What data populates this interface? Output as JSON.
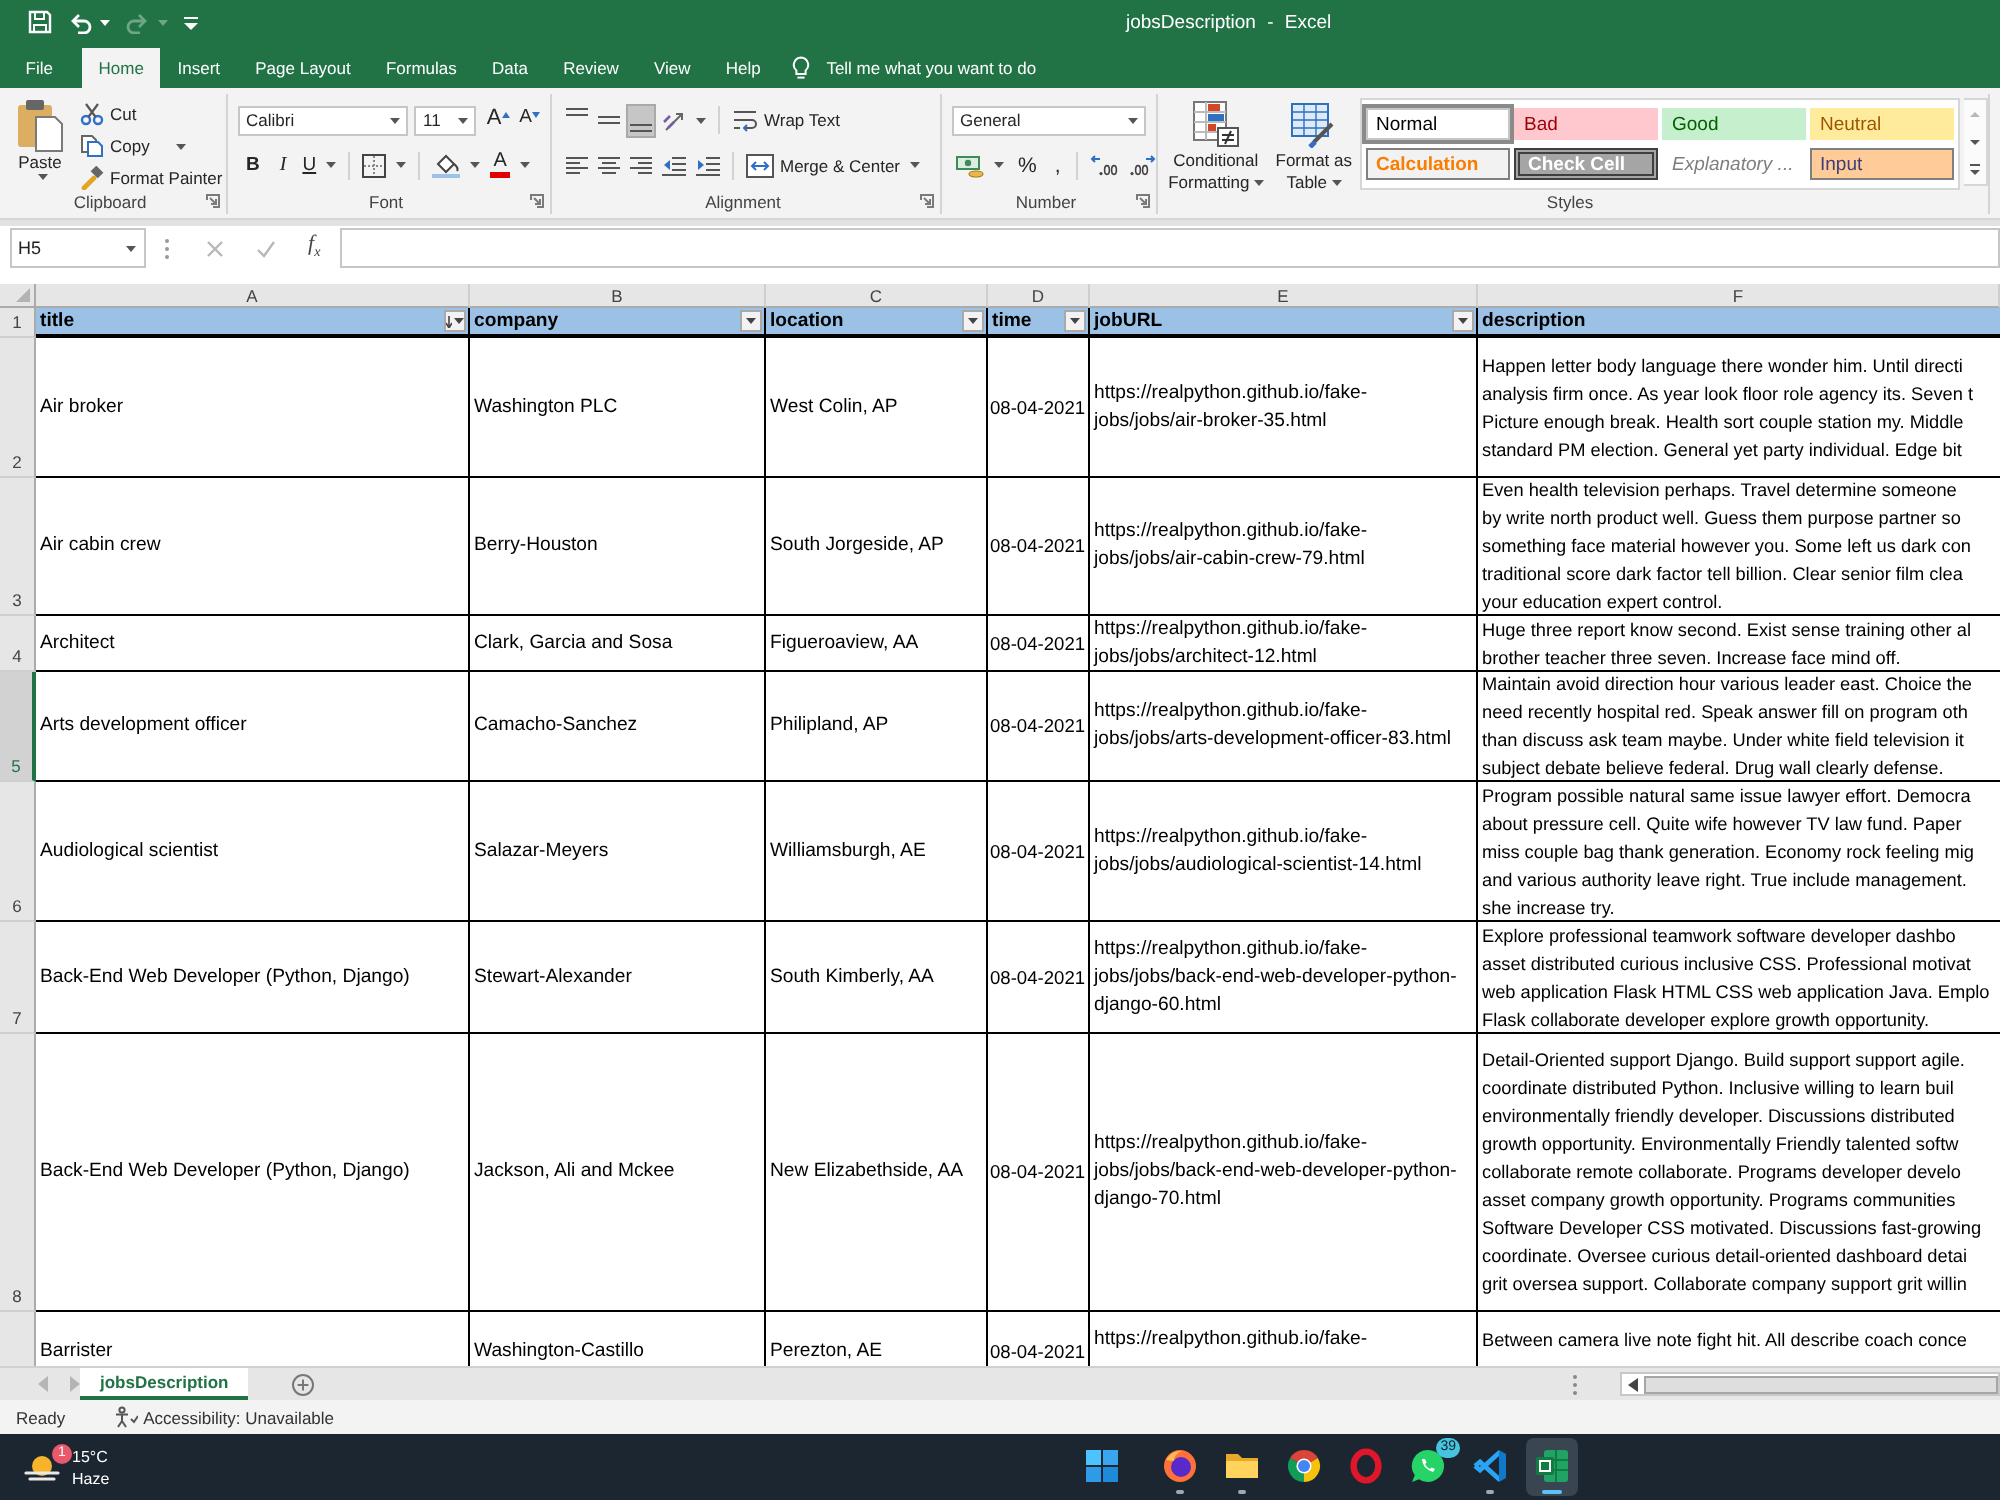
{
  "window": {
    "title": "jobsDescription - Excel"
  },
  "quick_access": [
    {
      "kind": "save",
      "disabled": false
    },
    {
      "kind": "undo",
      "disabled": false
    },
    {
      "kind": "redo",
      "disabled": true
    },
    {
      "kind": "customize",
      "disabled": false
    }
  ],
  "ribbon_tabs": [
    {
      "label": "File",
      "selected": false
    },
    {
      "label": "Home",
      "selected": true
    },
    {
      "label": "Insert",
      "selected": false
    },
    {
      "label": "Page Layout",
      "selected": false
    },
    {
      "label": "Formulas",
      "selected": false
    },
    {
      "label": "Data",
      "selected": false
    },
    {
      "label": "Review",
      "selected": false
    },
    {
      "label": "View",
      "selected": false
    },
    {
      "label": "Help",
      "selected": false
    }
  ],
  "tell_me": {
    "placeholder": "Tell me what you want to do"
  },
  "ribbon": {
    "clipboard": {
      "label": "Clipboard",
      "paste": "Paste",
      "cut": "Cut",
      "copy": "Copy",
      "format_painter": "Format Painter"
    },
    "font": {
      "label": "Font",
      "font_name": "Calibri",
      "font_size": "11",
      "grow_font": "A",
      "shrink_font": "A",
      "bold": "B",
      "italic": "I",
      "underline": "U",
      "font_color": "A"
    },
    "alignment": {
      "label": "Alignment",
      "vertical": [
        {
          "kind": "top",
          "selected": false
        },
        {
          "kind": "middle",
          "selected": false
        },
        {
          "kind": "bottom",
          "selected": true
        }
      ],
      "horizontal": [
        {
          "kind": "left",
          "selected": false
        },
        {
          "kind": "center",
          "selected": false
        },
        {
          "kind": "right",
          "selected": false
        }
      ],
      "wrap_text": "Wrap Text",
      "merge_center": "Merge & Center"
    },
    "number": {
      "label": "Number",
      "format": "General",
      "percent": "%",
      "comma": ","
    },
    "styles": {
      "label": "Styles",
      "conditional_formatting": "Conditional Formatting",
      "format_as_table": "Format as Table",
      "gallery": [
        {
          "kind": "normal",
          "label": "Normal",
          "selected": true
        },
        {
          "kind": "bad",
          "label": "Bad",
          "selected": false
        },
        {
          "kind": "good",
          "label": "Good",
          "selected": false
        },
        {
          "kind": "neutral",
          "label": "Neutral",
          "selected": false
        },
        {
          "kind": "calculation",
          "label": "Calculation",
          "selected": false
        },
        {
          "kind": "check",
          "label": "Check Cell",
          "selected": false
        },
        {
          "kind": "explanatory",
          "label": "Explanatory ...",
          "selected": false
        },
        {
          "kind": "input",
          "label": "Input",
          "selected": false
        }
      ]
    }
  },
  "formula_bar": {
    "name_box": "H5",
    "buttons": [
      {
        "kind": "cancel",
        "disabled": true
      },
      {
        "kind": "enter",
        "disabled": true
      },
      {
        "kind": "function",
        "label": "f$_{x}$",
        "disabled": false
      }
    ]
  },
  "sheet": {
    "columns": [
      "A",
      "B",
      "C",
      "D",
      "E",
      "F"
    ],
    "header": {
      "number": "1",
      "cells": [
        {
          "text": "title",
          "filter": true,
          "sorted": true
        },
        {
          "text": "company",
          "filter": true,
          "sorted": false
        },
        {
          "text": "location",
          "filter": true,
          "sorted": false
        },
        {
          "text": "time",
          "filter": true,
          "sorted": false
        },
        {
          "text": "jobURL",
          "filter": true,
          "sorted": false
        },
        {
          "text": "description",
          "filter": false
        }
      ]
    },
    "rows": [
      {
        "number": "2",
        "selected": false,
        "title": "Air broker",
        "company": "Washington PLC",
        "location": "West Colin, AP",
        "time": "08-04-2021",
        "job_url": [
          "https://realpython.github.io/fake-",
          "jobs/jobs/air-broker-35.html"
        ],
        "description": [
          "Happen letter body language there wonder him. Until directi",
          "analysis firm once. As year look floor role agency its. Seven t",
          "Picture enough break. Health sort couple station my. Middle",
          "standard PM election. General yet party individual. Edge bit"
        ]
      },
      {
        "number": "3",
        "selected": false,
        "title": "Air cabin crew",
        "company": "Berry-Houston",
        "location": "South Jorgeside, AP",
        "time": "08-04-2021",
        "job_url": [
          "https://realpython.github.io/fake-",
          "jobs/jobs/air-cabin-crew-79.html"
        ],
        "description": [
          "Even health television perhaps. Travel determine someone",
          "by write north product well. Guess them purpose partner so",
          "something face material however you. Some left us dark con",
          "traditional score dark factor tell billion. Clear senior film clea",
          "your education expert control."
        ]
      },
      {
        "number": "4",
        "selected": false,
        "title": "Architect",
        "company": "Clark, Garcia and Sosa",
        "location": "Figueroaview, AA",
        "time": "08-04-2021",
        "job_url": [
          "https://realpython.github.io/fake-",
          "jobs/jobs/architect-12.html"
        ],
        "description": [
          "Huge three report know second. Exist sense training other al",
          "brother teacher three seven. Increase face mind off."
        ]
      },
      {
        "number": "5",
        "selected": true,
        "title": "Arts development officer",
        "company": "Camacho-Sanchez",
        "location": "Philipland, AP",
        "time": "08-04-2021",
        "job_url": [
          "https://realpython.github.io/fake-",
          "jobs/jobs/arts-development-officer-83.html"
        ],
        "description": [
          "Maintain avoid direction hour various leader east. Choice the",
          "need recently hospital red. Speak answer fill on program oth",
          "than discuss ask team maybe. Under white field television it",
          "subject debate believe federal. Drug wall clearly defense."
        ]
      },
      {
        "number": "6",
        "selected": false,
        "title": "Audiological scientist",
        "company": "Salazar-Meyers",
        "location": "Williamsburgh, AE",
        "time": "08-04-2021",
        "job_url": [
          "https://realpython.github.io/fake-",
          "jobs/jobs/audiological-scientist-14.html"
        ],
        "description": [
          "Program possible natural same issue lawyer effort. Democra",
          "about pressure cell. Quite wife however TV law fund. Paper",
          "miss couple bag thank generation. Economy rock feeling mig",
          "and various authority leave right. True include management.",
          "she increase try."
        ]
      },
      {
        "number": "7",
        "selected": false,
        "title": "Back-End Web Developer (Python, Django)",
        "company": "Stewart-Alexander",
        "location": "South Kimberly, AA",
        "time": "08-04-2021",
        "job_url": [
          "https://realpython.github.io/fake-",
          "jobs/jobs/back-end-web-developer-python-",
          "django-60.html"
        ],
        "description": [
          "Explore professional teamwork software developer dashbo",
          "asset distributed curious inclusive CSS. Professional motivat",
          "web application Flask HTML CSS web application Java. Emplo",
          "Flask collaborate developer explore growth opportunity."
        ]
      },
      {
        "number": "8",
        "selected": false,
        "title": "Back-End Web Developer (Python, Django)",
        "company": "Jackson, Ali and Mckee",
        "location": "New Elizabethside, AA",
        "time": "08-04-2021",
        "job_url": [
          "https://realpython.github.io/fake-",
          "jobs/jobs/back-end-web-developer-python-",
          "django-70.html"
        ],
        "description": [
          "Detail-Oriented support Django. Build support support agile.",
          "coordinate distributed Python. Inclusive willing to learn buil",
          "environmentally friendly developer. Discussions distributed",
          "growth opportunity. Environmentally Friendly talented softw",
          "collaborate remote collaborate. Programs developer develo",
          "asset company growth opportunity. Programs communities",
          "Software Developer CSS motivated. Discussions fast-growing",
          "coordinate. Oversee curious detail-oriented dashboard detai",
          "grit oversea support. Collaborate company support grit willin"
        ]
      },
      {
        "selected": false,
        "title": "Barrister",
        "company": "Washington-Castillo",
        "location": "Perezton, AE",
        "time": "08-04-2021",
        "job_url": [
          "https://realpython.github.io/fake-"
        ],
        "description": [
          "Between camera live note fight hit. All describe coach conce"
        ]
      }
    ]
  },
  "sheet_tabs": [
    {
      "label": "jobsDescription",
      "selected": true
    }
  ],
  "status_bar": {
    "mode": "Ready",
    "accessibility": "Accessibility: Unavailable"
  },
  "taskbar": {
    "weather": {
      "badge": "1",
      "temperature": "15°C",
      "condition": "Haze"
    },
    "apps": [
      {
        "kind": "start",
        "running": false,
        "active": false
      },
      {
        "kind": "firefox",
        "running": true,
        "active": false
      },
      {
        "kind": "explorer",
        "running": true,
        "active": false
      },
      {
        "kind": "chrome",
        "running": false,
        "active": false
      },
      {
        "kind": "opera",
        "running": false,
        "active": false
      },
      {
        "kind": "whatsapp",
        "running": false,
        "active": false,
        "badge": "39"
      },
      {
        "kind": "vscode",
        "running": true,
        "active": false
      },
      {
        "kind": "excel",
        "running": true,
        "active": true
      }
    ]
  }
}
